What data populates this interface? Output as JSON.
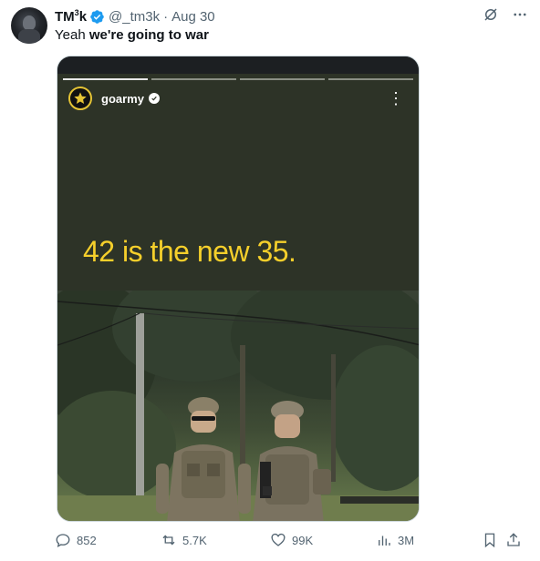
{
  "tweet": {
    "display_name": "TM",
    "display_name_sup": "3",
    "display_name_suffix": "k",
    "handle": "@_tm3k",
    "dot": "·",
    "date": "Aug 30",
    "text_plain": "Yeah ",
    "text_bold": "we're going to war"
  },
  "media": {
    "account": "goarmy",
    "headline": "42 is the new 35.",
    "progress_segments": 4,
    "progress_active": 1
  },
  "actions": {
    "replies": "852",
    "reposts": "5.7K",
    "likes": "99K",
    "views": "3M"
  },
  "colors": {
    "verified": "#1d9bf0",
    "headline": "#f5cf2b",
    "story_bg": "#2d3327",
    "muted": "#536471"
  },
  "icons": [
    "verified-icon",
    "grok-icon",
    "more-icon",
    "star-logo-icon",
    "reply-icon",
    "repost-icon",
    "like-icon",
    "views-icon",
    "bookmark-icon",
    "share-icon"
  ]
}
